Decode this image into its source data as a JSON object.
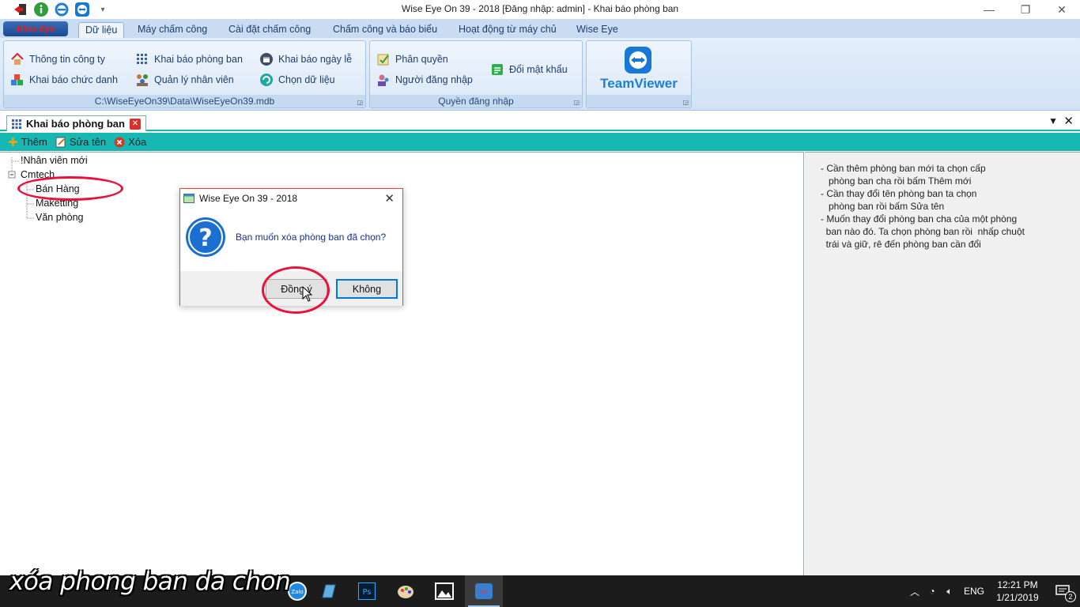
{
  "window": {
    "title": "Wise Eye On 39 - 2018 [Đăng nhập: admin] - Khai báo phòng ban"
  },
  "ribbon": {
    "logo_text": "Wise Eye",
    "tabs": [
      {
        "label": "Dữ liệu"
      },
      {
        "label": "Máy chấm công"
      },
      {
        "label": "Cài đặt chấm công"
      },
      {
        "label": "Chấm công và báo biểu"
      },
      {
        "label": "Hoạt động từ máy chủ"
      },
      {
        "label": "Wise Eye"
      }
    ],
    "group1": {
      "caption": "C:\\WiseEyeOn39\\Data\\WiseEyeOn39.mdb",
      "buttons": [
        {
          "label": "Thông tin công ty"
        },
        {
          "label": "Khai báo chức danh"
        },
        {
          "label": "Khai báo phòng ban"
        },
        {
          "label": "Quản lý nhân viên"
        },
        {
          "label": "Khai báo ngày lễ"
        },
        {
          "label": "Chọn dữ liệu"
        }
      ]
    },
    "group2": {
      "caption": "Quyền đăng nhập",
      "buttons": [
        {
          "label": "Phân quyền"
        },
        {
          "label": "Người đăng nhập"
        },
        {
          "label": "Đổi mật khẩu"
        }
      ]
    },
    "group3": {
      "label": "TeamViewer"
    }
  },
  "document_tab": {
    "label": "Khai báo phòng ban"
  },
  "toolbar": {
    "add_label": "Thêm",
    "rename_label": "Sửa tên",
    "delete_label": "Xóa"
  },
  "tree": {
    "nodes": [
      {
        "label": "!Nhân viên mới"
      },
      {
        "label": "Cmtech"
      },
      {
        "label": "Bán Hàng"
      },
      {
        "label": "Maketting"
      },
      {
        "label": "Văn phòng"
      }
    ]
  },
  "help": {
    "lines": [
      "- Cần thêm phòng ban mới ta chọn cấp",
      "   phòng ban cha rồi bấm Thêm mới",
      "- Cần thay đổi tên phòng ban ta chọn",
      "   phòng ban rồi bấm Sửa tên",
      "- Muốn thay đổi phòng ban cha của một phòng",
      "  ban nào đó. Ta chọn phòng ban rồi  nhấp chuột",
      "  trái và giữ, rê đến phòng ban cần đổi"
    ]
  },
  "dialog": {
    "title": "Wise Eye On 39 - 2018",
    "message": "Bạn muốn xóa phòng ban đã chọn?",
    "ok_label": "Đồng ý",
    "cancel_label": "Không"
  },
  "caption_overlay": "xóa phong ban da chon",
  "taskbar": {
    "language": "ENG",
    "time": "12:21 PM",
    "date": "1/21/2019",
    "notification_count": "2",
    "apps": [
      "zalo-icon",
      "notes-icon",
      "photoshop-icon",
      "paint-icon",
      "photos-icon",
      "wise-eye-icon"
    ]
  },
  "colors": {
    "toolbar_bg": "#17b8b3",
    "ribbon_bg": "#d2e2f5",
    "annotation": "#e8123c",
    "dialog_border": "#d94a4a"
  }
}
